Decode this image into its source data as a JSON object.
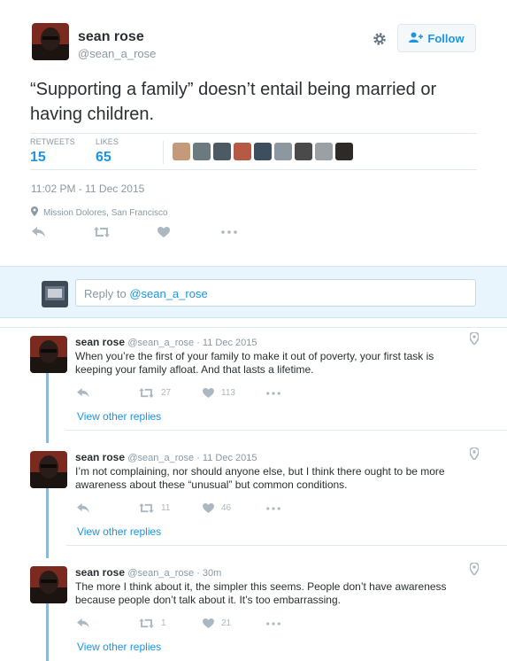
{
  "tweet": {
    "author_name": "sean rose",
    "author_handle": "@sean_a_rose",
    "follow_label": "Follow",
    "text": "“Supporting a family” doesn’t entail being married or having children.",
    "retweets_label": "RETWEETS",
    "retweets_count": "15",
    "likes_label": "LIKES",
    "likes_count": "65",
    "timestamp": "11:02 PM - 11 Dec 2015",
    "location": "Mission Dolores, San Francisco"
  },
  "liker_colors": [
    "#c49a7a",
    "#6b7a7e",
    "#4c5a64",
    "#b65a46",
    "#3d4f5e",
    "#8d97a0",
    "#4a4a4a",
    "#9aa0a3",
    "#2e2a27"
  ],
  "reply_box": {
    "prefix": "Reply to ",
    "handle": "@sean_a_rose"
  },
  "replies": [
    {
      "name": "sean rose",
      "meta": "@sean_a_rose · 11 Dec 2015",
      "text": "When you’re the first of your family to make it out of poverty, your first task is keeping your family afloat. And that lasts a lifetime.",
      "retweets": "27",
      "likes": "113",
      "view_replies": "View other replies"
    },
    {
      "name": "sean rose",
      "meta": "@sean_a_rose · 11 Dec 2015",
      "text": "I’m not complaining, nor should anyone else, but I think there ought to be more awareness about these “unusual” but common conditions.",
      "retweets": "11",
      "likes": "46",
      "view_replies": "View other replies"
    },
    {
      "name": "sean rose",
      "meta": "@sean_a_rose · 30m",
      "text": "The more I think about it, the simpler this seems. People don’t have awareness because people don’t talk about it. It’s too embarrassing.",
      "retweets": "1",
      "likes": "21",
      "view_replies": "View other replies"
    }
  ],
  "colors": {
    "accent": "#1b95e0",
    "muted": "#8899a6",
    "thread_line": "#8fb8d8",
    "reply_bar": "#e8f5fd"
  }
}
